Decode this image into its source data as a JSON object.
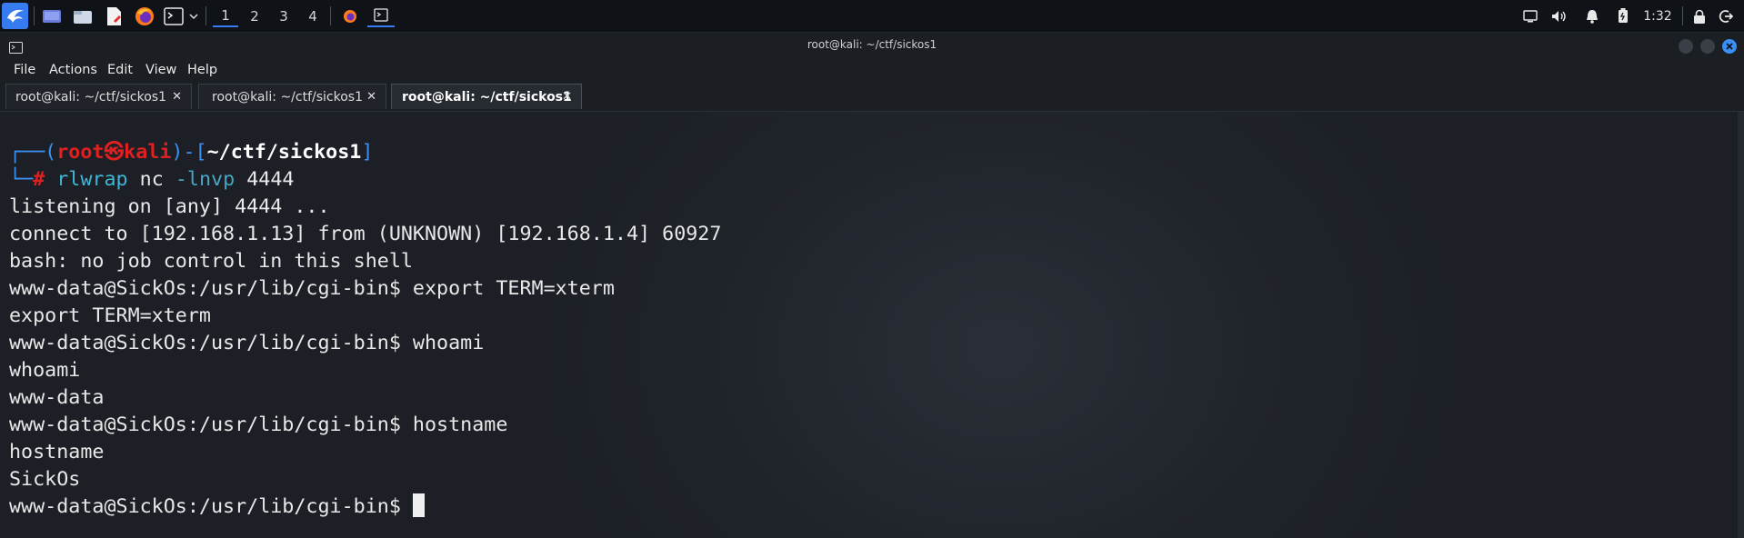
{
  "panel": {
    "workspaces": [
      "1",
      "2",
      "3",
      "4"
    ],
    "clock": "1:32"
  },
  "window": {
    "title": "root@kali: ~/ctf/sickos1"
  },
  "menu": [
    "File",
    "Actions",
    "Edit",
    "View",
    "Help"
  ],
  "tabs": [
    {
      "label": "root@kali: ~/ctf/sickos1",
      "active": false
    },
    {
      "label": "root@kali: ~/ctf/sickos1",
      "active": false
    },
    {
      "label": "root@kali: ~/ctf/sickos1",
      "active": true
    }
  ],
  "terminal": {
    "prompt_user": "root",
    "prompt_skull": "㉿",
    "prompt_host": "kali",
    "prompt_dir": "~/ctf/sickos1",
    "cmd_name": "rlwrap",
    "cmd_arg1": "nc",
    "cmd_flag": "-lnvp",
    "cmd_port": "4444",
    "output": [
      "listening on [any] 4444 ...",
      "connect to [192.168.1.13] from (UNKNOWN) [192.168.1.4] 60927",
      "bash: no job control in this shell",
      "www-data@SickOs:/usr/lib/cgi-bin$ export TERM=xterm",
      "export TERM=xterm",
      "www-data@SickOs:/usr/lib/cgi-bin$ whoami",
      "whoami",
      "www-data",
      "www-data@SickOs:/usr/lib/cgi-bin$ hostname",
      "hostname",
      "SickOs"
    ],
    "final_prompt": "www-data@SickOs:/usr/lib/cgi-bin$ "
  }
}
